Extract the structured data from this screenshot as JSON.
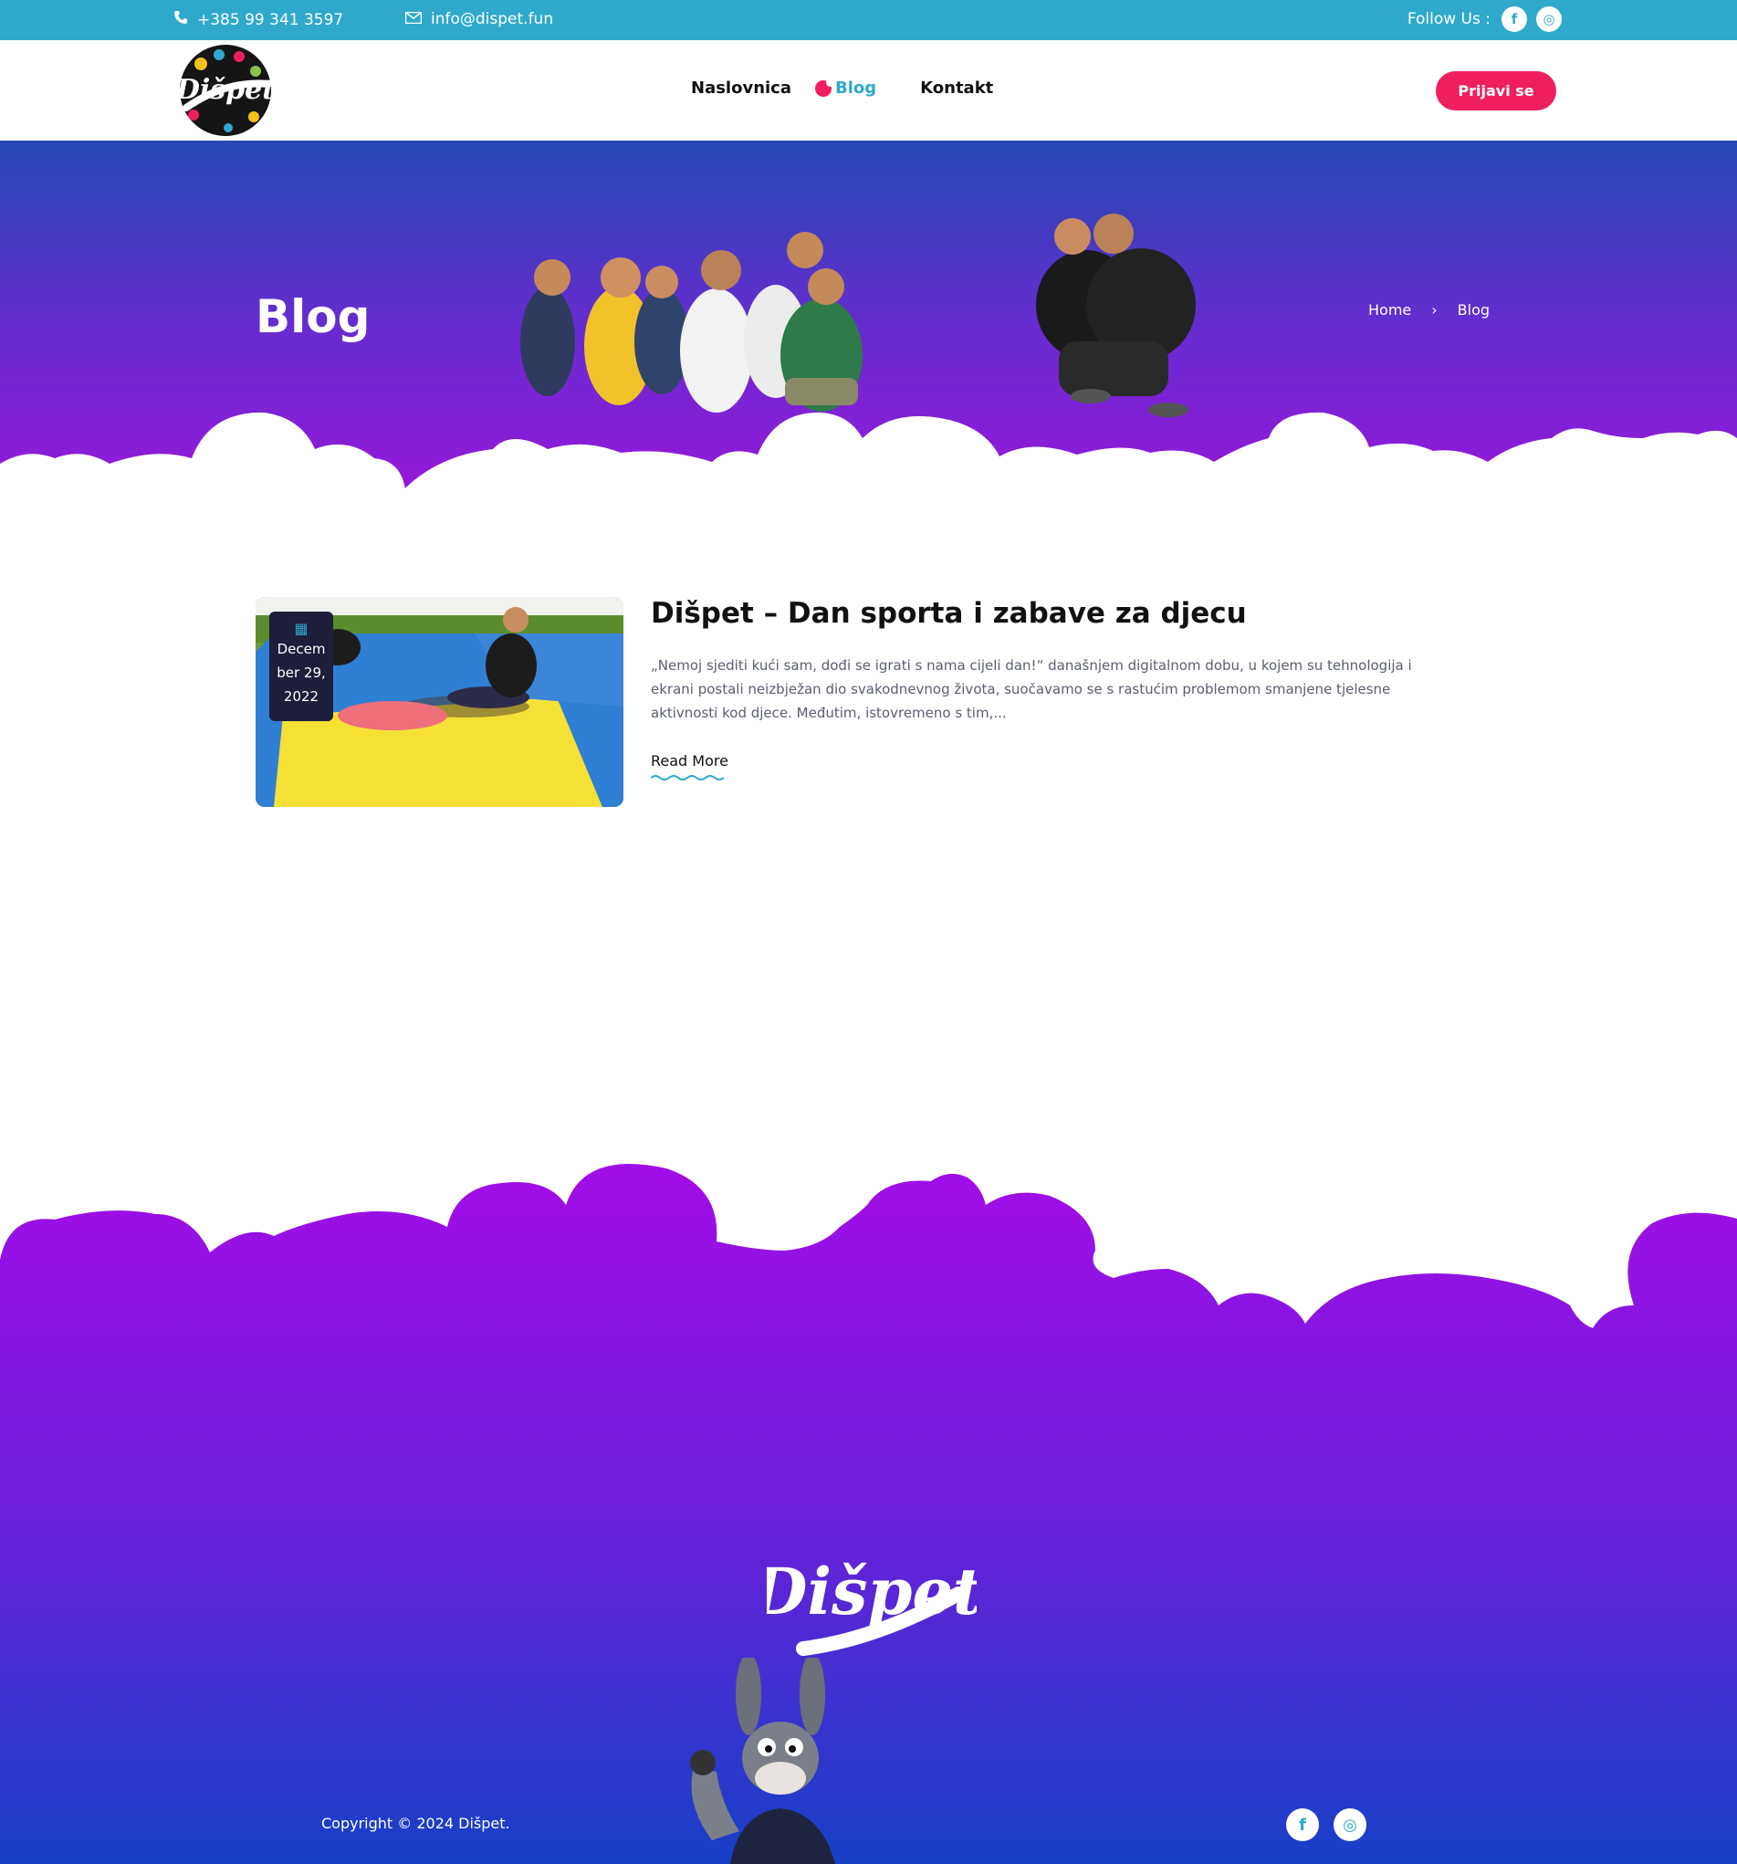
{
  "topbar": {
    "phone": "+385 99 341 3597",
    "email": "info@dispet.fun",
    "follow_label": "Follow Us :",
    "facebook_glyph": "f",
    "instagram_glyph": "◎"
  },
  "header": {
    "logo_text": "Dišpet",
    "nav": [
      {
        "label": "Naslovnica"
      },
      {
        "label": "Blog"
      },
      {
        "label": "Kontakt"
      }
    ],
    "cta_label": "Prijavi se"
  },
  "hero": {
    "title": "Blog",
    "breadcrumb_home": "Home",
    "breadcrumb_sep": "›",
    "breadcrumb_current": "Blog"
  },
  "post": {
    "date_line1": "Decem",
    "date_line2": "ber 29,",
    "date_line3": "2022",
    "title": "Dišpet – Dan sporta i zabave za djecu",
    "excerpt": "„Nemoj sjediti kući sam, dođi se igrati s nama cijeli dan!“  današnjem digitalnom dobu, u kojem su tehnologija i ekrani postali neizbježan dio svakodnevnog života, suočavamo se s rastućim problemom smanjene tjelesne aktivnosti kod djece. Međutim, istovremeno s tim,...",
    "read_more": "Read More"
  },
  "footer": {
    "logo_text": "Dišpet",
    "copyright": "Copyright © 2024 Dišpet."
  },
  "colors": {
    "topbar": "#2ea9cc",
    "accent_pink": "#ef1f5e",
    "purple": "#9817d9",
    "blue": "#2449b3"
  }
}
